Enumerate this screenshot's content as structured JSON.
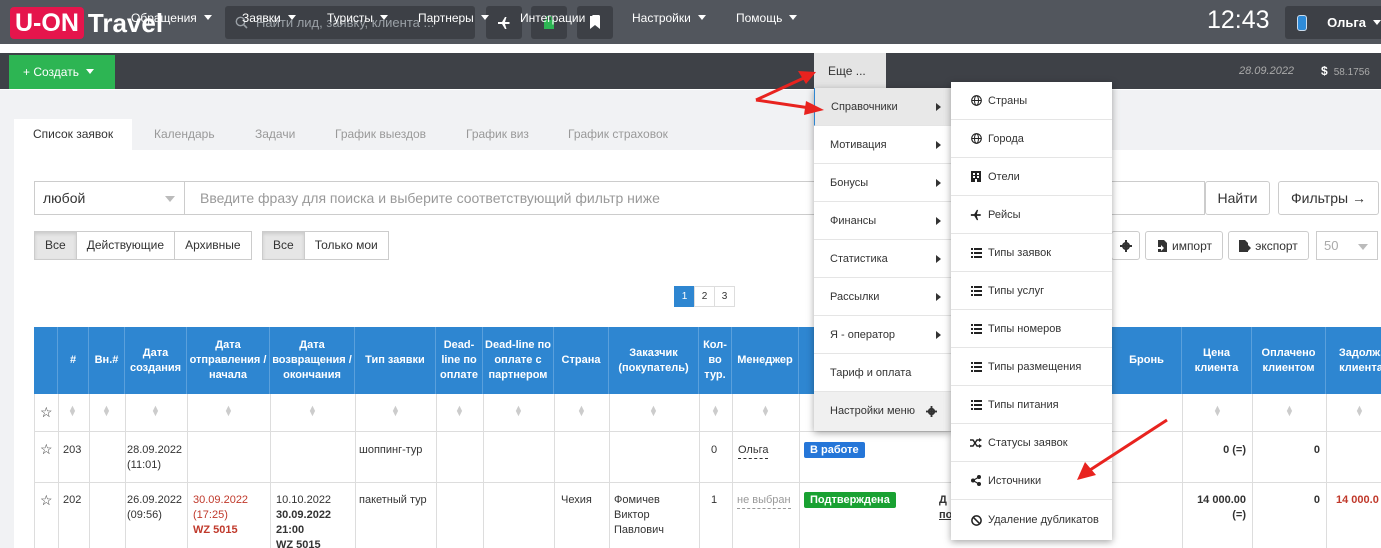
{
  "topbar": {
    "logo_box": "U-ON",
    "logo_rest": "Travel",
    "search_placeholder": "Найти лид, заявку, клиента ...",
    "clock": "12:43",
    "user_name": "Ольга"
  },
  "nav": {
    "create": "+ Создать",
    "items": [
      "Обращения",
      "Заявки",
      "Туристы",
      "Партнеры",
      "Интеграции",
      "Настройки",
      "Помощь"
    ],
    "more": "Еще ...",
    "date": "28.09.2022",
    "currency": "$",
    "balance": "58.1756"
  },
  "tabs": [
    "Список заявок",
    "Календарь",
    "Задачи",
    "График выездов",
    "График виз",
    "График страховок"
  ],
  "filter": {
    "select_value": "любой",
    "phrase_placeholder": "Введите фразу для поиска и выберите соответствующий фильтр ниже",
    "find_button": "Найти",
    "filters_button": "Фильтры →"
  },
  "segments1": [
    "Все",
    "Действующие",
    "Архивные"
  ],
  "segments2": [
    "Все",
    "Только мои"
  ],
  "actions": {
    "import": "импорт",
    "export": "экспорт",
    "per_page": "50"
  },
  "pager": [
    "1",
    "2",
    "3"
  ],
  "table": {
    "headers": [
      "#",
      "Вн.#",
      "Дата создания",
      "Дата отправления / начала",
      "Дата возвращения / окончания",
      "Тип заявки",
      "Dead-line по оплате",
      "Dead-line по оплате с партнером",
      "Страна",
      "Заказчик (покупатель)",
      "Кол-во тур.",
      "Менеджер",
      "Бронь",
      "Цена клиента",
      "Оплачено клиентом",
      "Задолж. клиента"
    ],
    "rows": [
      {
        "num": "203",
        "created": "28.09.2022",
        "created_time": "(11:01)",
        "type": "шоппинг-тур",
        "count": "0",
        "manager": "Ольга",
        "status": "В работе",
        "price": "0 (=)",
        "paid": "0"
      },
      {
        "num": "202",
        "created": "26.09.2022",
        "created_time": "(09:56)",
        "dep_date": "30.09.2022",
        "dep_time": "(17:25)",
        "dep_flight": "WZ 5015",
        "ret_date": "10.10.2022",
        "ret_date2": "30.09.2022",
        "ret_time": "21:00",
        "ret_flight": "WZ 5015",
        "type": "пакетный тур",
        "country": "Чехия",
        "customer1": "Фомичев",
        "customer2": "Виктор",
        "customer3": "Павлович",
        "count": "1",
        "manager": "не выбран",
        "status": "Подтверждена",
        "extra_top": "Д",
        "extra_bottom": "по",
        "price": "14 000.00",
        "price2": "(=)",
        "paid": "0",
        "debt": "14 000.0"
      }
    ]
  },
  "menu1": {
    "items": [
      "Справочники",
      "Мотивация",
      "Бонусы",
      "Финансы",
      "Статистика",
      "Рассылки",
      "Я - оператор",
      "Тариф и оплата",
      "Настройки меню"
    ]
  },
  "menu2": {
    "items": [
      {
        "label": "Страны",
        "icon": "globe-icon"
      },
      {
        "label": "Города",
        "icon": "globe-icon"
      },
      {
        "label": "Отели",
        "icon": "building-icon"
      },
      {
        "label": "Рейсы",
        "icon": "plane-icon"
      },
      {
        "label": "Типы заявок",
        "icon": "list-icon"
      },
      {
        "label": "Типы услуг",
        "icon": "list-icon"
      },
      {
        "label": "Типы номеров",
        "icon": "list-icon"
      },
      {
        "label": "Типы размещения",
        "icon": "list-icon"
      },
      {
        "label": "Типы питания",
        "icon": "list-icon"
      },
      {
        "label": "Статусы заявок",
        "icon": "shuffle-icon"
      },
      {
        "label": "Источники",
        "icon": "share-icon"
      },
      {
        "label": "Удаление дубликатов",
        "icon": "ban-icon"
      }
    ]
  },
  "colors": {
    "accent_blue": "#2e86d1",
    "create_green": "#2db553",
    "logo_red": "#e5154c",
    "arrow_red": "#e8231f",
    "status_blue": "#2576d8",
    "status_green": "#19a132"
  }
}
